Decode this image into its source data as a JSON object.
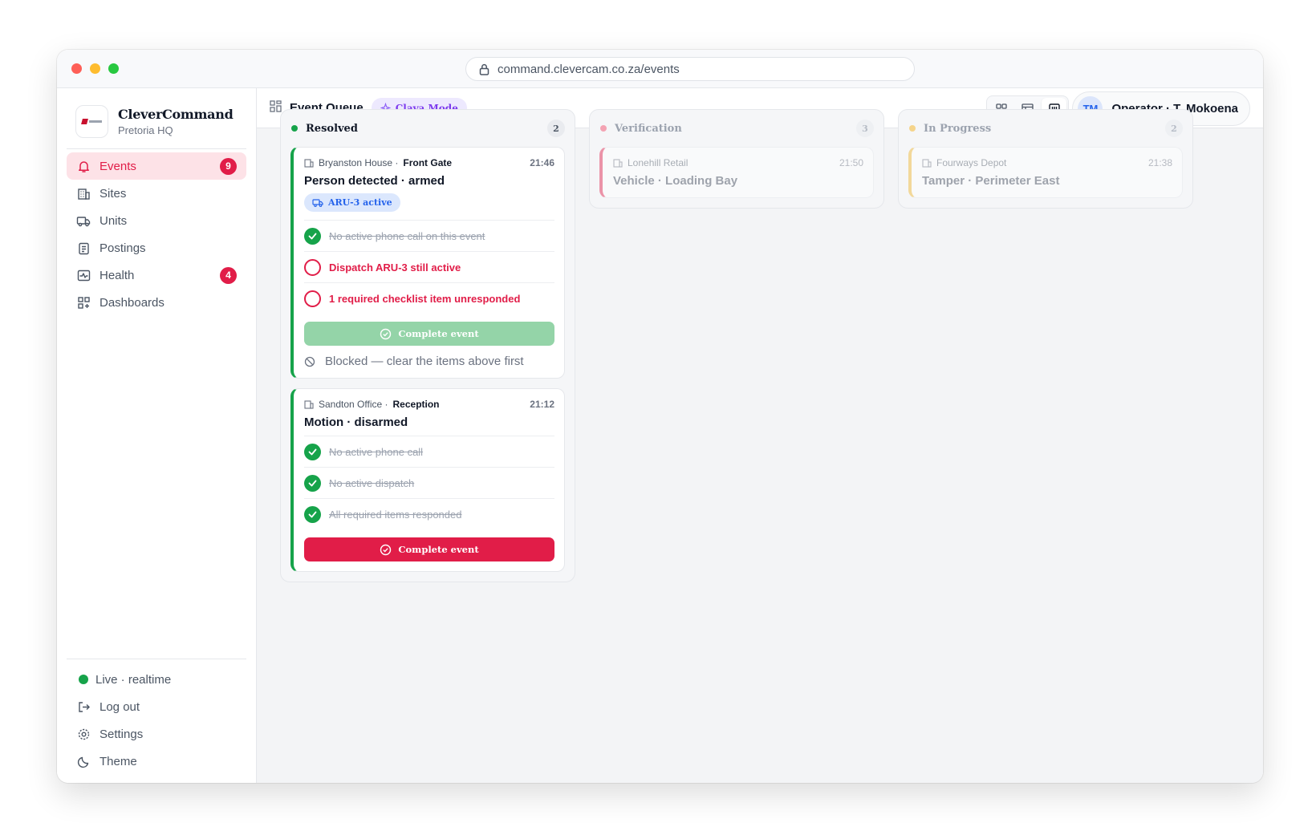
{
  "browser": {
    "url": "command.clevercam.co.za/events"
  },
  "brand": {
    "name": "CleverCommand",
    "location": "Pretoria HQ"
  },
  "nav": [
    {
      "label": "Events",
      "icon": "bell-icon",
      "badge": "9",
      "active": true
    },
    {
      "label": "Sites",
      "icon": "building-icon"
    },
    {
      "label": "Units",
      "icon": "truck-icon"
    },
    {
      "label": "Postings",
      "icon": "clipboard-icon"
    },
    {
      "label": "Health",
      "icon": "pulse-icon",
      "badge": "4"
    },
    {
      "label": "Dashboards",
      "icon": "dashboard-icon"
    }
  ],
  "footer": {
    "live": "Live · realtime",
    "logout": "Log out",
    "settings": "Settings",
    "theme": "Theme"
  },
  "topbar": {
    "title": "Event Queue",
    "mode": "Clava Mode",
    "operator_initials": "TM",
    "operator": "Operator · T. Mokoena"
  },
  "columns": [
    {
      "title": "Resolved",
      "count": "2",
      "color": "#16a34a",
      "cards": [
        {
          "site": "Bryanston House ·",
          "zone": "Front Gate",
          "time": "21:46",
          "title": "Person detected · armed",
          "unit": "ARU-3 active",
          "checks": [
            {
              "text": "No active phone call on this event",
              "done": true
            },
            {
              "text": "Dispatch ARU-3 still active",
              "done": false
            },
            {
              "text": "1 required checklist item unresponded",
              "done": false
            }
          ],
          "button": "Complete event",
          "blocked": "Blocked — clear the items above first"
        },
        {
          "site": "Sandton Office ·",
          "zone": "Reception",
          "time": "21:12",
          "title": "Motion · disarmed",
          "checks": [
            {
              "text": "No active phone call",
              "done": true
            },
            {
              "text": "No active dispatch",
              "done": true
            },
            {
              "text": "All required items responded",
              "done": true
            }
          ],
          "button": "Complete event"
        }
      ]
    },
    {
      "title": "Verification",
      "count": "3",
      "color": "#f4a3b3",
      "cards": [
        {
          "site": "Lonehill Retail",
          "time": "21:50",
          "title": "Vehicle · Loading Bay",
          "accent": "#f4a3b3"
        }
      ]
    },
    {
      "title": "In Progress",
      "count": "2",
      "color": "#f5d48b",
      "cards": [
        {
          "site": "Fourways Depot",
          "time": "21:38",
          "title": "Tamper · Perimeter East",
          "accent": "#f5d48b"
        }
      ]
    }
  ]
}
